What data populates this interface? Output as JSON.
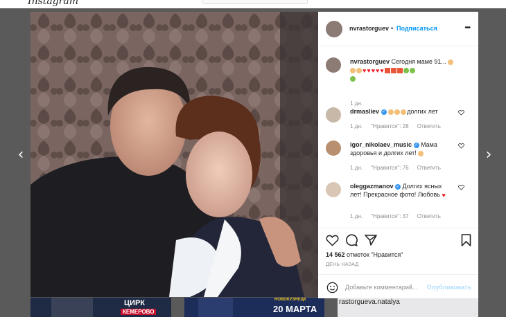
{
  "colors": {
    "accent": "#0095f6",
    "muted": "#8e8e8e",
    "panel_bg": "#ffffff",
    "overlay": "#5a5a5a"
  },
  "nav": {
    "prev_icon": "‹",
    "next_icon": "›"
  },
  "post": {
    "author": "nvrastorguev",
    "follow_label": "Подписаться",
    "separator": "•",
    "caption_text": "Сегодня маме 91...",
    "caption_time": "1 дн.",
    "likes_count": "14 562",
    "likes_suffix": "отметок \"Нравится\"",
    "time_ago": "ДЕНЬ НАЗАД",
    "comment_placeholder": "Добавьте комментарий...",
    "publish_label": "Опубликовать"
  },
  "comments": [
    {
      "user": "drmasliev",
      "verified": true,
      "text": "долгих лет",
      "time": "1 дн.",
      "likes": "\"Нравится\": 28",
      "reply": "Ответить"
    },
    {
      "user": "igor_nikolaev_music",
      "verified": true,
      "text": "Мама здоровья и долгих лет!",
      "time": "1 дн.",
      "likes": "\"Нравится\": 76",
      "reply": "Ответить"
    },
    {
      "user": "oleggazmanov",
      "verified": true,
      "text": "Долгих ясных лет! Прекрасное фото! Любовь",
      "time": "1 дн.",
      "likes": "\"Нравится\": 37",
      "reply": "Ответить"
    }
  ],
  "thumbs": [
    {
      "label": "ЦИРК",
      "sub": "КЕМЕРОВО"
    },
    {
      "label": "НОВОКУЗНЕЦК",
      "sub": "20 МАРТА"
    },
    {
      "label": "rastorgueva.natalya"
    }
  ]
}
